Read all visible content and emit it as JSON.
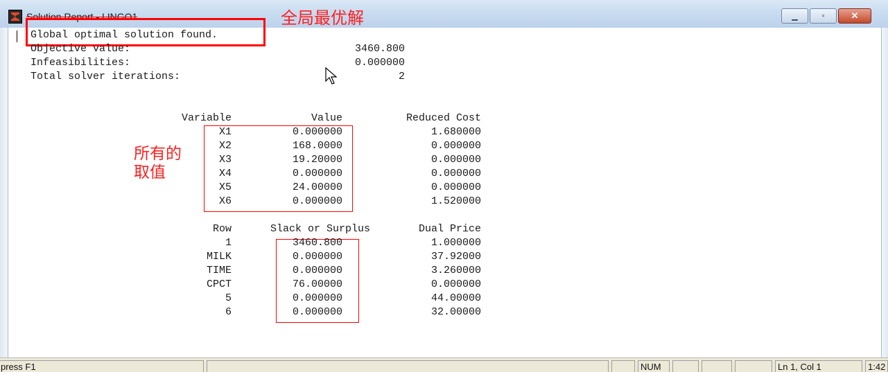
{
  "window": {
    "title": "Solution Report - LINGO1",
    "minimize_icon": "minimize-icon",
    "maximize_icon": "maximize-icon",
    "close_icon": "close-icon"
  },
  "report": {
    "status_line": "Global optimal solution found.",
    "summary": [
      {
        "label": "Objective value:",
        "value": "3460.800"
      },
      {
        "label": "Infeasibilities:",
        "value": "0.000000"
      },
      {
        "label": "Total solver iterations:",
        "value": "2"
      }
    ],
    "variables": {
      "headers": [
        "Variable",
        "Value",
        "Reduced Cost"
      ],
      "rows": [
        {
          "name": "X1",
          "value": "0.000000",
          "cost": "1.680000"
        },
        {
          "name": "X2",
          "value": "168.0000",
          "cost": "0.000000"
        },
        {
          "name": "X3",
          "value": "19.20000",
          "cost": "0.000000"
        },
        {
          "name": "X4",
          "value": "0.000000",
          "cost": "0.000000"
        },
        {
          "name": "X5",
          "value": "24.00000",
          "cost": "0.000000"
        },
        {
          "name": "X6",
          "value": "0.000000",
          "cost": "1.520000"
        }
      ]
    },
    "rows_table": {
      "headers": [
        "Row",
        "Slack or Surplus",
        "Dual Price"
      ],
      "rows": [
        {
          "name": "1",
          "slack": "3460.800",
          "dual": "1.000000"
        },
        {
          "name": "MILK",
          "slack": "0.000000",
          "dual": "37.92000"
        },
        {
          "name": "TIME",
          "slack": "0.000000",
          "dual": "3.260000"
        },
        {
          "name": "CPCT",
          "slack": "76.00000",
          "dual": "0.000000"
        },
        {
          "name": "5",
          "slack": "0.000000",
          "dual": "44.00000"
        },
        {
          "name": "6",
          "slack": "0.000000",
          "dual": "32.00000"
        }
      ]
    }
  },
  "annotations": {
    "global_optimum": "全局最优解",
    "all_values_line1": "所有的",
    "all_values_line2": "取值",
    "color": "#ff0000"
  },
  "statusbar": {
    "help": "press F1",
    "num": "NUM",
    "position": "Ln 1, Col 1",
    "time": "1:42"
  }
}
